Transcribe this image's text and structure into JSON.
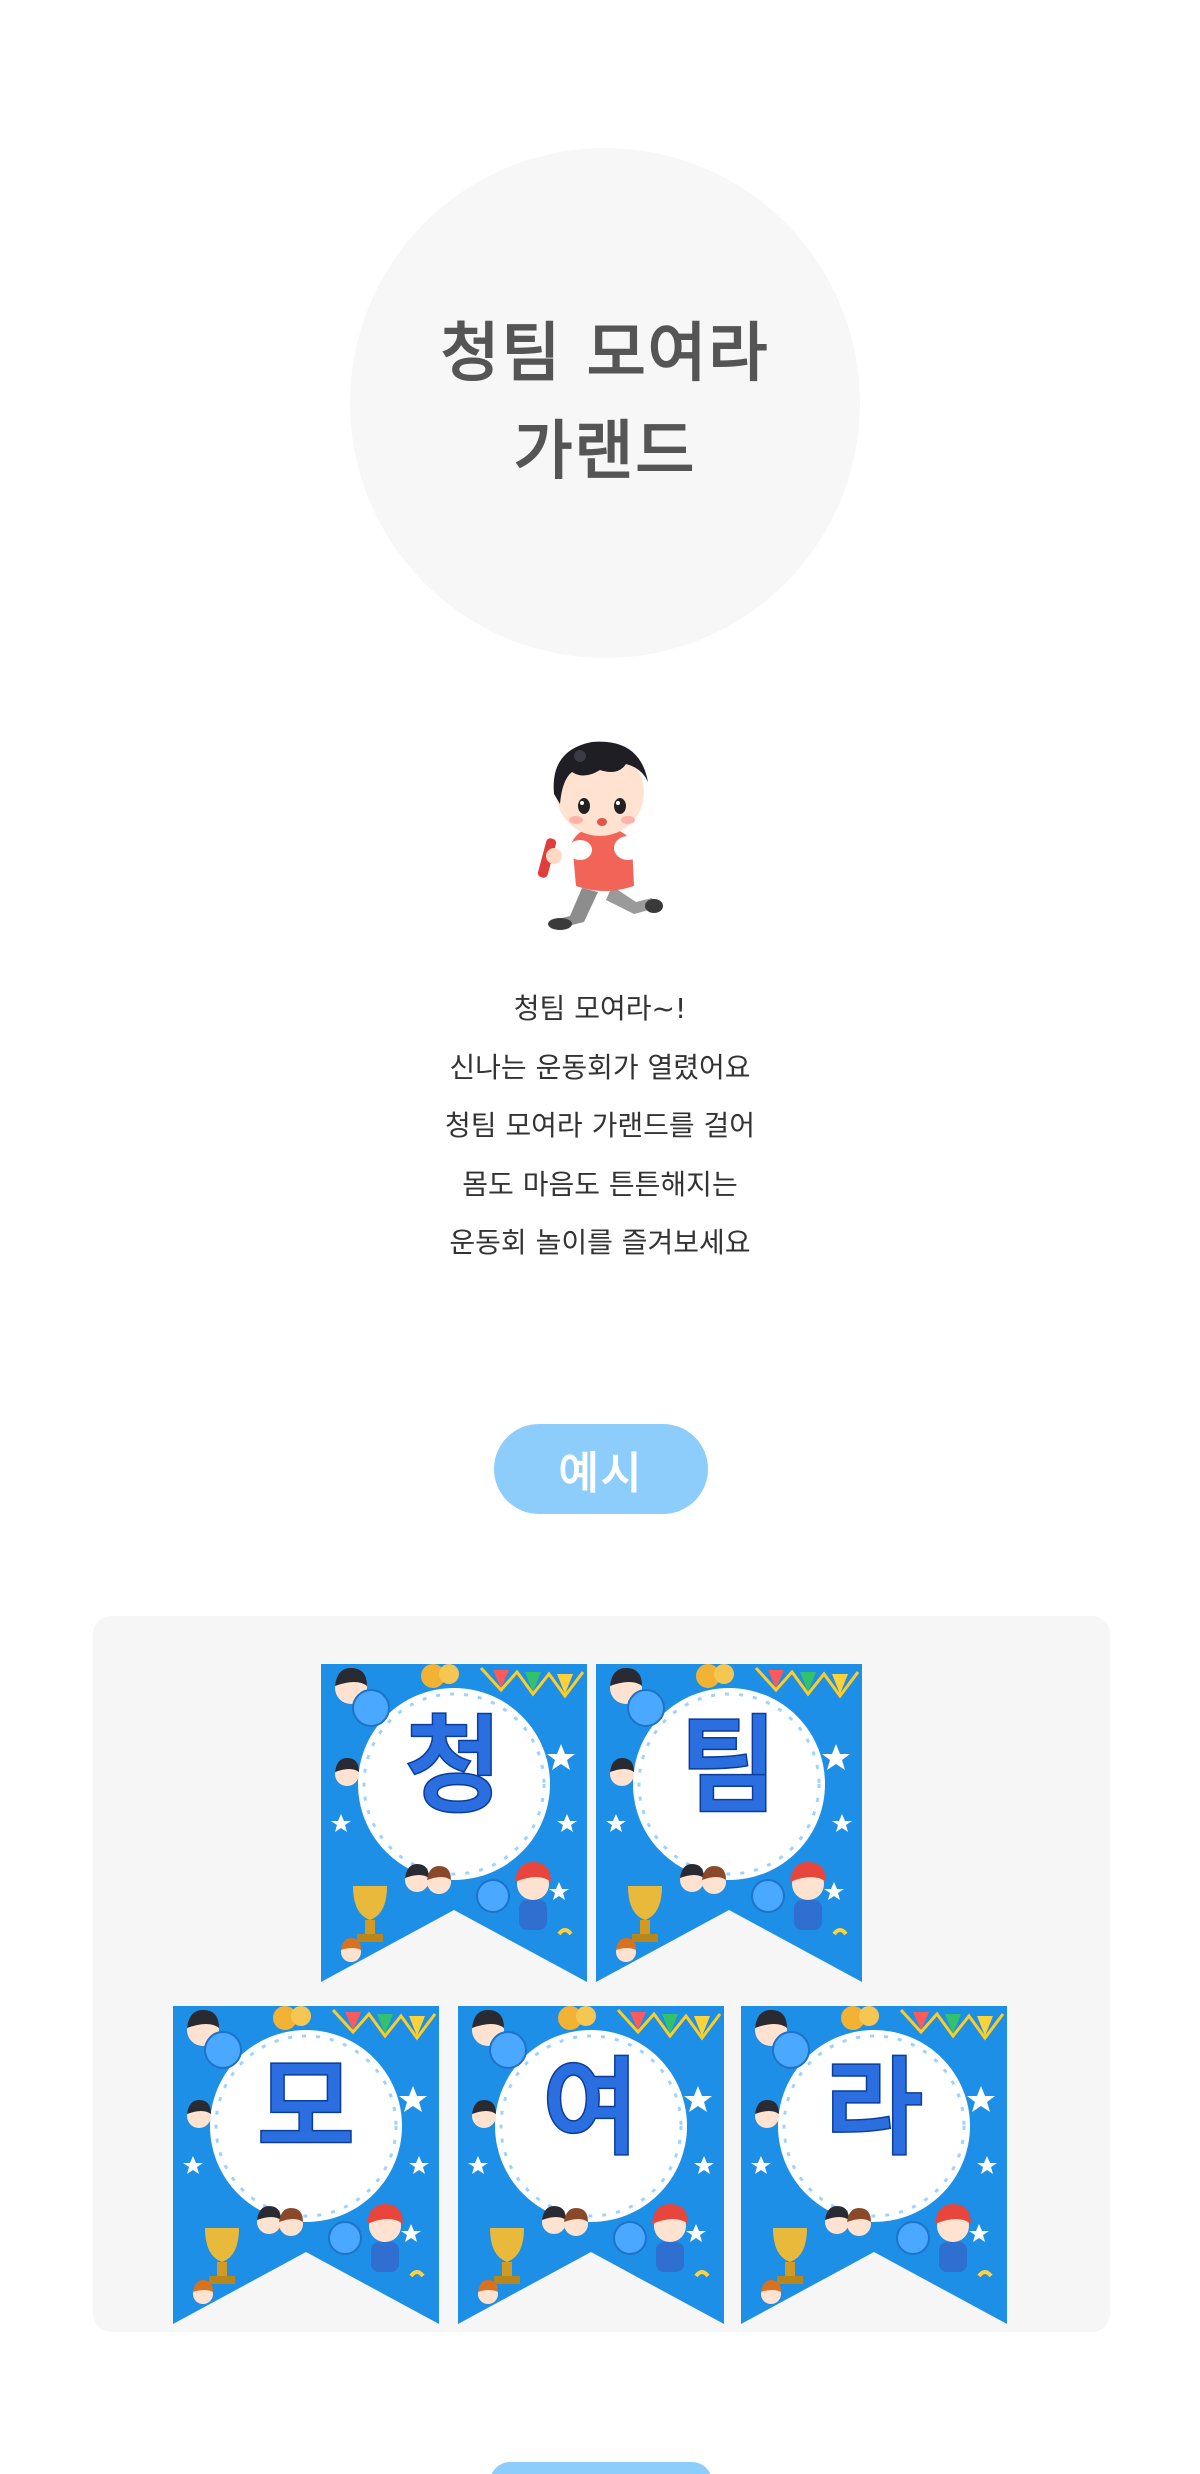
{
  "title": {
    "line1": "청팀 모여라",
    "line2": "가랜드"
  },
  "intro": [
    "청팀 모여라~!",
    "신나는 운동회가 열렸어요",
    "청팀 모여라 가랜드를 걸어",
    "몸도 마음도 튼튼해지는",
    "운동회 놀이를 즐겨보세요"
  ],
  "example_label": "예시",
  "garland": {
    "row1": [
      "청",
      "팀"
    ],
    "row2": [
      "모",
      "여",
      "라"
    ]
  },
  "colors": {
    "title_bg": "#f7f7f7",
    "pill": "#8ccdfb",
    "pennant_blue": "#1e8fe6",
    "letter_blue": "#2363d9"
  },
  "icons": {
    "mascot": "running-boy-mascot"
  }
}
